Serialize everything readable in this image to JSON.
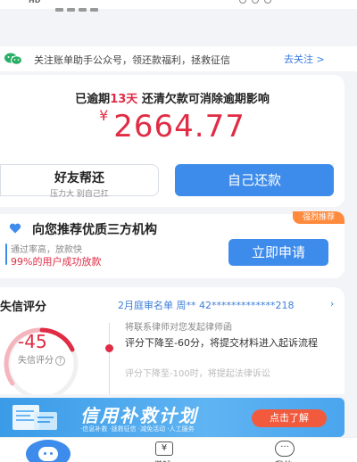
{
  "follow": {
    "text": "关注账单助手公众号，领还款福利，拯救征信",
    "link": "去关注 >"
  },
  "overdue": {
    "prefix": "已逾期",
    "days": "13天",
    "suffix": "还清欠款可消除逾期影响",
    "currency": "¥",
    "amount": "2664.77"
  },
  "actions": {
    "friend_title": "好友帮还",
    "friend_sub": "压力大 别自己扛",
    "self_label": "自己还款"
  },
  "recommend": {
    "badge": "强烈推荐",
    "title": "向您推荐优质三方机构",
    "sub1": "通过率高，放款快",
    "sub2": "99%的用户成功放款",
    "apply": "立即申请"
  },
  "credit": {
    "title": "失信评分",
    "notice": "2月庭审名单 周** 42*************218",
    "chevron": "›",
    "score": "-45",
    "score_label": "失信评分",
    "help": "?",
    "tl_1": "将联系律师对您发起律师函",
    "tl_2": "评分下降至-60分，将提交材料进入起诉流程",
    "tl_3": "评分下降至-100时，将提起法律诉讼"
  },
  "banner": {
    "title": "信用补救计划",
    "sub": "·信息补救 ·拯救征信 ·减免活动 ·人工服务",
    "button": "点击了解"
  },
  "tabs": {
    "borrow": "借钱",
    "mine": "我的"
  },
  "colors": {
    "accent": "#3d8bea",
    "danger": "#e02c45",
    "badge": "#ff8a3d",
    "banner_button": "#f25a3e"
  }
}
